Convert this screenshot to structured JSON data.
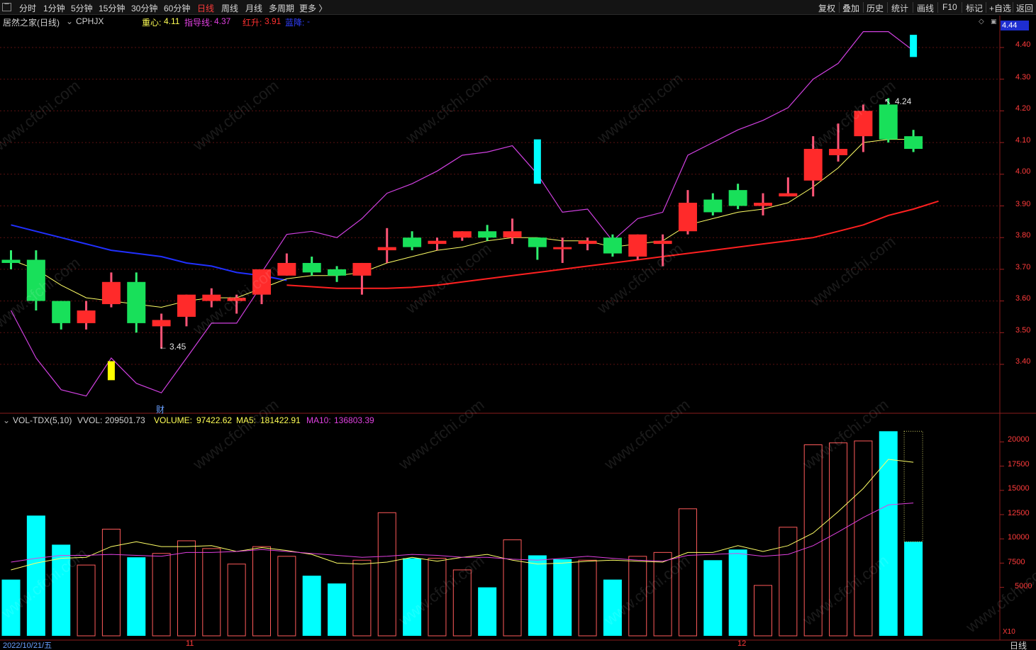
{
  "toolbar": {
    "periods": [
      "分时",
      "1分钟",
      "5分钟",
      "15分钟",
      "30分钟",
      "60分钟",
      "日线",
      "周线",
      "月线",
      "多周期",
      "更多 〉"
    ],
    "active_period": "日线",
    "right_buttons": [
      "复权",
      "叠加",
      "历史",
      "统计",
      "画线",
      "F10",
      "标记",
      "+自选",
      "返回"
    ]
  },
  "header": {
    "title": "居然之家(日线)",
    "indicator": "CPHJX",
    "zhongxin_label": "重心:",
    "zhongxin_value": "4.11",
    "zhidao_label": "指导线:",
    "zhidao_value": "4.37",
    "hongsheng_label": "红升:",
    "hongsheng_value": "3.91",
    "lanjiang_label": "蓝降:",
    "lanjiang_value": "-"
  },
  "current_price": "4.44",
  "price_axis": [
    "4.40",
    "4.30",
    "4.20",
    "4.10",
    "4.00",
    "3.90",
    "3.80",
    "3.70",
    "3.60",
    "3.50",
    "3.40"
  ],
  "annotations": {
    "high": "4.24",
    "low": "3.45",
    "cai": "财"
  },
  "volume_header": {
    "name": "VOL-TDX(5,10)",
    "vvol_label": "VVOL:",
    "vvol_value": "209501.73",
    "volume_label": "VOLUME:",
    "volume_value": "97422.62",
    "ma5_label": "MA5:",
    "ma5_value": "181422.91",
    "ma10_label": "MA10:",
    "ma10_value": "136803.39"
  },
  "volume_axis": [
    "20000",
    "17500",
    "15000",
    "12500",
    "10000",
    "7500",
    "5000"
  ],
  "volume_axis_unit": "X10",
  "footer": {
    "date": "2022/10/21/五",
    "month_11": "11",
    "month_12": "12",
    "period": "日线"
  },
  "watermark": "www.cfchi.com",
  "colors": {
    "up": "#ff2a2a",
    "down": "#18e05a",
    "vol_down": "#00ffff",
    "ma_line": "#ffff66",
    "guide": "#d040e0",
    "red_line": "#ff2020",
    "blue_line": "#2030ff"
  },
  "chart_data": {
    "type": "candlestick",
    "candles": [
      {
        "o": 3.73,
        "c": 3.72,
        "h": 3.76,
        "l": 3.7
      },
      {
        "o": 3.73,
        "c": 3.6,
        "h": 3.76,
        "l": 3.57
      },
      {
        "o": 3.6,
        "c": 3.53,
        "h": 3.6,
        "l": 3.51
      },
      {
        "o": 3.53,
        "c": 3.57,
        "h": 3.6,
        "l": 3.51
      },
      {
        "o": 3.59,
        "c": 3.66,
        "h": 3.69,
        "l": 3.58
      },
      {
        "o": 3.66,
        "c": 3.53,
        "h": 3.69,
        "l": 3.5
      },
      {
        "o": 3.52,
        "c": 3.54,
        "h": 3.56,
        "l": 3.45
      },
      {
        "o": 3.55,
        "c": 3.62,
        "h": 3.62,
        "l": 3.52
      },
      {
        "o": 3.6,
        "c": 3.62,
        "h": 3.64,
        "l": 3.58
      },
      {
        "o": 3.6,
        "c": 3.61,
        "h": 3.62,
        "l": 3.56
      },
      {
        "o": 3.62,
        "c": 3.7,
        "h": 3.7,
        "l": 3.59
      },
      {
        "o": 3.68,
        "c": 3.72,
        "h": 3.75,
        "l": 3.68
      },
      {
        "o": 3.72,
        "c": 3.69,
        "h": 3.74,
        "l": 3.68
      },
      {
        "o": 3.7,
        "c": 3.68,
        "h": 3.71,
        "l": 3.66
      },
      {
        "o": 3.68,
        "c": 3.72,
        "h": 3.72,
        "l": 3.62
      },
      {
        "o": 3.76,
        "c": 3.77,
        "h": 3.83,
        "l": 3.72
      },
      {
        "o": 3.8,
        "c": 3.77,
        "h": 3.82,
        "l": 3.76
      },
      {
        "o": 3.78,
        "c": 3.79,
        "h": 3.8,
        "l": 3.76
      },
      {
        "o": 3.8,
        "c": 3.82,
        "h": 3.82,
        "l": 3.79
      },
      {
        "o": 3.82,
        "c": 3.8,
        "h": 3.84,
        "l": 3.79
      },
      {
        "o": 3.8,
        "c": 3.82,
        "h": 3.86,
        "l": 3.78
      },
      {
        "o": 3.8,
        "c": 3.77,
        "h": 3.8,
        "l": 3.73
      },
      {
        "o": 3.77,
        "c": 3.77,
        "h": 3.8,
        "l": 3.72
      },
      {
        "o": 3.78,
        "c": 3.79,
        "h": 3.8,
        "l": 3.76
      },
      {
        "o": 3.8,
        "c": 3.75,
        "h": 3.81,
        "l": 3.74
      },
      {
        "o": 3.74,
        "c": 3.81,
        "h": 3.81,
        "l": 3.73
      },
      {
        "o": 3.78,
        "c": 3.79,
        "h": 3.81,
        "l": 3.71
      },
      {
        "o": 3.82,
        "c": 3.91,
        "h": 3.95,
        "l": 3.81
      },
      {
        "o": 3.92,
        "c": 3.88,
        "h": 3.94,
        "l": 3.87
      },
      {
        "o": 3.95,
        "c": 3.9,
        "h": 3.97,
        "l": 3.89
      },
      {
        "o": 3.9,
        "c": 3.91,
        "h": 3.94,
        "l": 3.87
      },
      {
        "o": 3.93,
        "c": 3.94,
        "h": 3.99,
        "l": 3.93
      },
      {
        "o": 3.98,
        "c": 4.08,
        "h": 4.12,
        "l": 3.93
      },
      {
        "o": 4.06,
        "c": 4.08,
        "h": 4.16,
        "l": 4.04
      },
      {
        "o": 4.12,
        "c": 4.2,
        "h": 4.22,
        "l": 4.07
      },
      {
        "o": 4.22,
        "c": 4.11,
        "h": 4.24,
        "l": 4.1
      },
      {
        "o": 4.12,
        "c": 4.08,
        "h": 4.14,
        "l": 4.07
      }
    ],
    "ma": [
      3.73,
      3.7,
      3.65,
      3.61,
      3.6,
      3.59,
      3.58,
      3.6,
      3.61,
      3.61,
      3.64,
      3.67,
      3.68,
      3.68,
      3.69,
      3.72,
      3.74,
      3.76,
      3.77,
      3.79,
      3.8,
      3.8,
      3.79,
      3.79,
      3.77,
      3.78,
      3.79,
      3.84,
      3.86,
      3.88,
      3.89,
      3.91,
      3.96,
      4.02,
      4.1,
      4.11,
      4.11
    ],
    "guide_upper": [
      null,
      null,
      null,
      null,
      null,
      null,
      null,
      null,
      null,
      null,
      3.69,
      3.81,
      3.82,
      3.8,
      3.86,
      3.94,
      3.97,
      4.01,
      4.06,
      4.07,
      4.09,
      4.0,
      3.88,
      3.89,
      3.79,
      3.86,
      3.88,
      4.06,
      4.1,
      4.14,
      4.17,
      4.21,
      4.3,
      4.35,
      4.45,
      4.45,
      4.39
    ],
    "guide_lower": [
      3.57,
      3.42,
      3.32,
      3.3,
      3.42,
      3.34,
      3.31,
      3.42,
      3.53,
      3.53,
      3.65
    ],
    "red_line": [
      null,
      null,
      null,
      null,
      null,
      null,
      null,
      null,
      null,
      null,
      null,
      3.65,
      3.645,
      3.64,
      3.64,
      3.64,
      3.643,
      3.65,
      3.66,
      3.67,
      3.68,
      3.69,
      3.7,
      3.71,
      3.72,
      3.73,
      3.74,
      3.75,
      3.76,
      3.77,
      3.78,
      3.79,
      3.8,
      3.82,
      3.84,
      3.87,
      3.89,
      3.915
    ],
    "blue_line": [
      3.84,
      3.82,
      3.8,
      3.78,
      3.76,
      3.75,
      3.74,
      3.72,
      3.71,
      3.69,
      3.68,
      3.665
    ],
    "cyan_markers": [
      {
        "i": 21,
        "top": 4.11,
        "bottom": 3.97
      },
      {
        "i": 36,
        "top": 4.44,
        "bottom": 4.37
      }
    ],
    "yellow_marker": {
      "i": 4,
      "top": 3.41,
      "bottom": 3.35
    },
    "volume": [
      5800,
      12400,
      9400,
      7300,
      11000,
      8100,
      8500,
      9800,
      9000,
      7400,
      9200,
      8200,
      6200,
      5400,
      7800,
      12700,
      8000,
      8000,
      6800,
      5000,
      9900,
      8300,
      7900,
      7800,
      5800,
      8200,
      8600,
      13100,
      7800,
      8900,
      5200,
      11200,
      19700,
      19900,
      20100,
      21100,
      9700
    ],
    "volume_up": [
      false,
      false,
      false,
      true,
      true,
      false,
      true,
      true,
      true,
      true,
      true,
      true,
      false,
      false,
      true,
      true,
      false,
      true,
      true,
      false,
      true,
      false,
      false,
      true,
      false,
      true,
      true,
      true,
      false,
      false,
      true,
      true,
      true,
      true,
      true,
      false,
      false
    ],
    "vol_ma5": [
      6800,
      7500,
      8000,
      8100,
      9200,
      9700,
      9200,
      9200,
      9300,
      8700,
      9100,
      8800,
      8400,
      7500,
      7400,
      7600,
      8100,
      7700,
      8100,
      8400,
      7800,
      7400,
      7500,
      7700,
      7800,
      7700,
      7600,
      8600,
      8600,
      9300,
      8700,
      9300,
      10600,
      12800,
      15200,
      18200,
      17900
    ],
    "vol_ma10": [
      7600,
      8000,
      8300,
      8300,
      8400,
      8300,
      8200,
      8600,
      8600,
      8700,
      8900,
      8700,
      8500,
      8300,
      8100,
      8200,
      8400,
      8300,
      8100,
      8100,
      7900,
      7800,
      8000,
      8200,
      8000,
      7800,
      7700,
      8300,
      8400,
      8500,
      8200,
      8400,
      9300,
      10700,
      12200,
      13500,
      13700
    ]
  }
}
